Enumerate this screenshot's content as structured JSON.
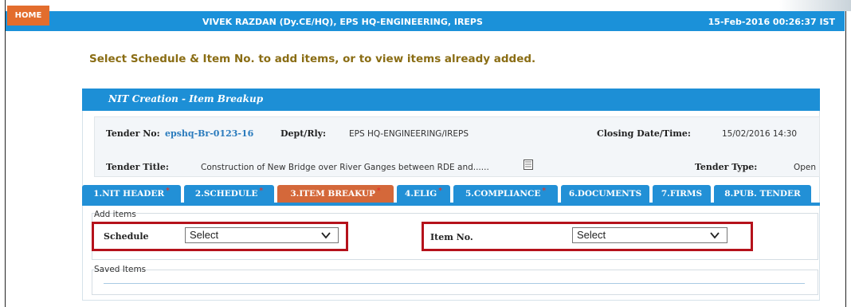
{
  "header": {
    "home_label": "HOME",
    "user_info": "VIVEK RAZDAN (Dy.CE/HQ), EPS HQ-ENGINEERING, IREPS",
    "datetime": "15-Feb-2016 00:26:37 IST"
  },
  "instruction": "Select Schedule & Item No. to add items, or to view items already added.",
  "panel": {
    "title": "NIT Creation - Item Breakup"
  },
  "tender": {
    "tender_no_label": "Tender No:",
    "tender_no": "epshq-Br-0123-16",
    "dept_label": "Dept/Rly:",
    "dept": "EPS HQ-ENGINEERING/IREPS",
    "closing_label": "Closing Date/Time:",
    "closing": "15/02/2016 14:30",
    "title_label": "Tender Title:",
    "title": "Construction of New Bridge over River Ganges between RDE and......",
    "type_label": "Tender Type:",
    "type": "Open"
  },
  "tabs": [
    {
      "label": "1.NIT HEADER",
      "required": true,
      "active": false
    },
    {
      "label": "2.SCHEDULE",
      "required": true,
      "active": false
    },
    {
      "label": "3.ITEM BREAKUP",
      "required": true,
      "active": true
    },
    {
      "label": "4.ELIG",
      "required": true,
      "active": false
    },
    {
      "label": "5.COMPLIANCE",
      "required": true,
      "active": false
    },
    {
      "label": "6.DOCUMENTS",
      "required": false,
      "active": false
    },
    {
      "label": "7.FIRMS",
      "required": false,
      "active": false
    },
    {
      "label": "8.PUB. TENDER",
      "required": false,
      "active": false
    }
  ],
  "tab_required_marker": "*",
  "add_items": {
    "legend": "Add items",
    "schedule_label": "Schedule",
    "schedule_value": "Select",
    "item_no_label": "Item No.",
    "item_no_value": "Select"
  },
  "saved_items": {
    "legend": "Saved Items"
  },
  "colors": {
    "header_blue": "#1b91d9",
    "home_orange": "#e36d2d",
    "active_tab": "#d4683a",
    "highlight_red": "#b5121b",
    "instruction_text": "#8a6d14"
  },
  "icons": {
    "doc": "document-icon",
    "dropdown": "chevron-down-icon"
  }
}
